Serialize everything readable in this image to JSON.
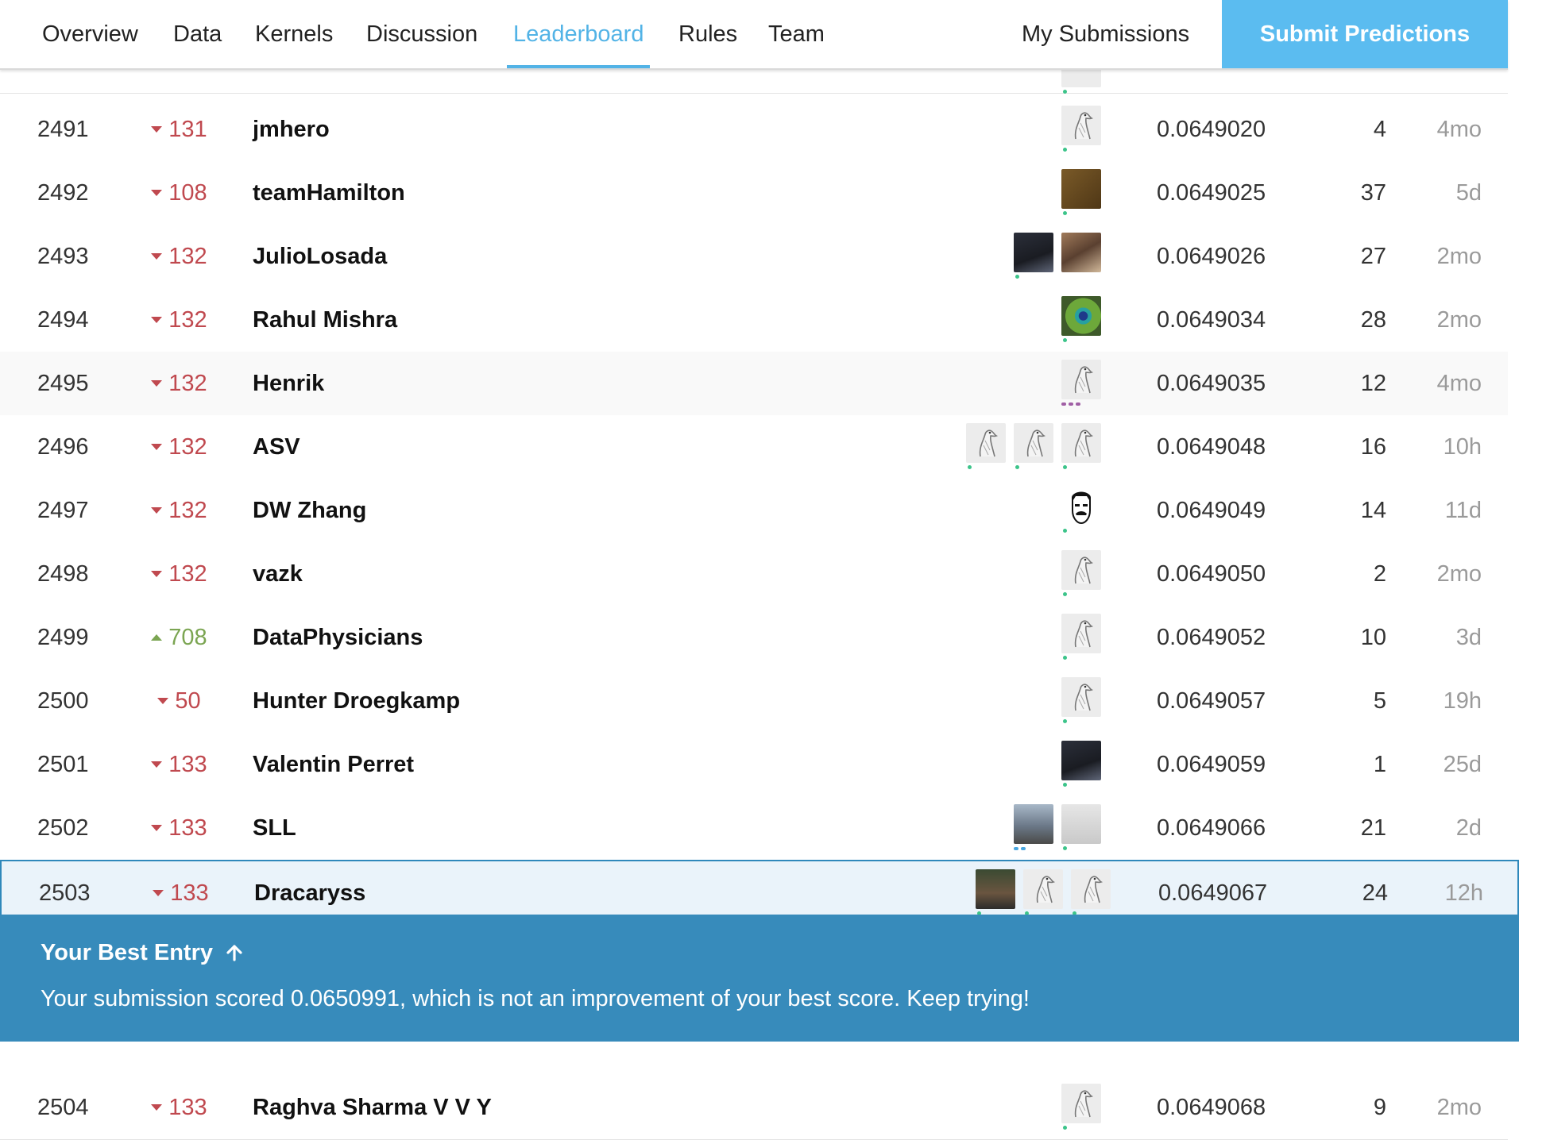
{
  "nav": {
    "tabs": [
      {
        "label": "Overview"
      },
      {
        "label": "Data"
      },
      {
        "label": "Kernels"
      },
      {
        "label": "Discussion"
      },
      {
        "label": "Leaderboard",
        "active": true
      },
      {
        "label": "Rules"
      },
      {
        "label": "Team"
      }
    ],
    "my_submissions": "My Submissions",
    "submit_predictions": "Submit Predictions"
  },
  "rows": [
    {
      "rank": "2491",
      "change": "131",
      "dir": "down",
      "team": "jmhero",
      "score": "0.0649020",
      "entries": "4",
      "last": "4mo"
    },
    {
      "rank": "2492",
      "change": "108",
      "dir": "down",
      "team": "teamHamilton",
      "score": "0.0649025",
      "entries": "37",
      "last": "5d"
    },
    {
      "rank": "2493",
      "change": "132",
      "dir": "down",
      "team": "JulioLosada",
      "score": "0.0649026",
      "entries": "27",
      "last": "2mo"
    },
    {
      "rank": "2494",
      "change": "132",
      "dir": "down",
      "team": "Rahul Mishra",
      "score": "0.0649034",
      "entries": "28",
      "last": "2mo"
    },
    {
      "rank": "2495",
      "change": "132",
      "dir": "down",
      "team": "Henrik",
      "score": "0.0649035",
      "entries": "12",
      "last": "4mo"
    },
    {
      "rank": "2496",
      "change": "132",
      "dir": "down",
      "team": "ASV",
      "score": "0.0649048",
      "entries": "16",
      "last": "10h"
    },
    {
      "rank": "2497",
      "change": "132",
      "dir": "down",
      "team": "DW Zhang",
      "score": "0.0649049",
      "entries": "14",
      "last": "11d"
    },
    {
      "rank": "2498",
      "change": "132",
      "dir": "down",
      "team": "vazk",
      "score": "0.0649050",
      "entries": "2",
      "last": "2mo"
    },
    {
      "rank": "2499",
      "change": "708",
      "dir": "up",
      "team": "DataPhysicians",
      "score": "0.0649052",
      "entries": "10",
      "last": "3d"
    },
    {
      "rank": "2500",
      "change": "50",
      "dir": "down",
      "team": "Hunter Droegkamp",
      "score": "0.0649057",
      "entries": "5",
      "last": "19h"
    },
    {
      "rank": "2501",
      "change": "133",
      "dir": "down",
      "team": "Valentin Perret",
      "score": "0.0649059",
      "entries": "1",
      "last": "25d"
    },
    {
      "rank": "2502",
      "change": "133",
      "dir": "down",
      "team": "SLL",
      "score": "0.0649066",
      "entries": "21",
      "last": "2d"
    },
    {
      "rank": "2503",
      "change": "133",
      "dir": "down",
      "team": "Dracaryss",
      "score": "0.0649067",
      "entries": "24",
      "last": "12h"
    },
    {
      "rank": "2504",
      "change": "133",
      "dir": "down",
      "team": "Raghva Sharma V V Y",
      "score": "0.0649068",
      "entries": "9",
      "last": "2mo"
    }
  ],
  "banner": {
    "title": "Your Best Entry",
    "arrow_icon": "arrow-up-icon",
    "message": "Your submission scored 0.0650991, which is not an improvement of your best score. Keep trying!"
  },
  "colors": {
    "accent": "#52b3e6",
    "submit_bg": "#5bbcf0",
    "banner_bg": "#378bbb",
    "rank_down": "#c0494f",
    "rank_up": "#7ba552"
  }
}
